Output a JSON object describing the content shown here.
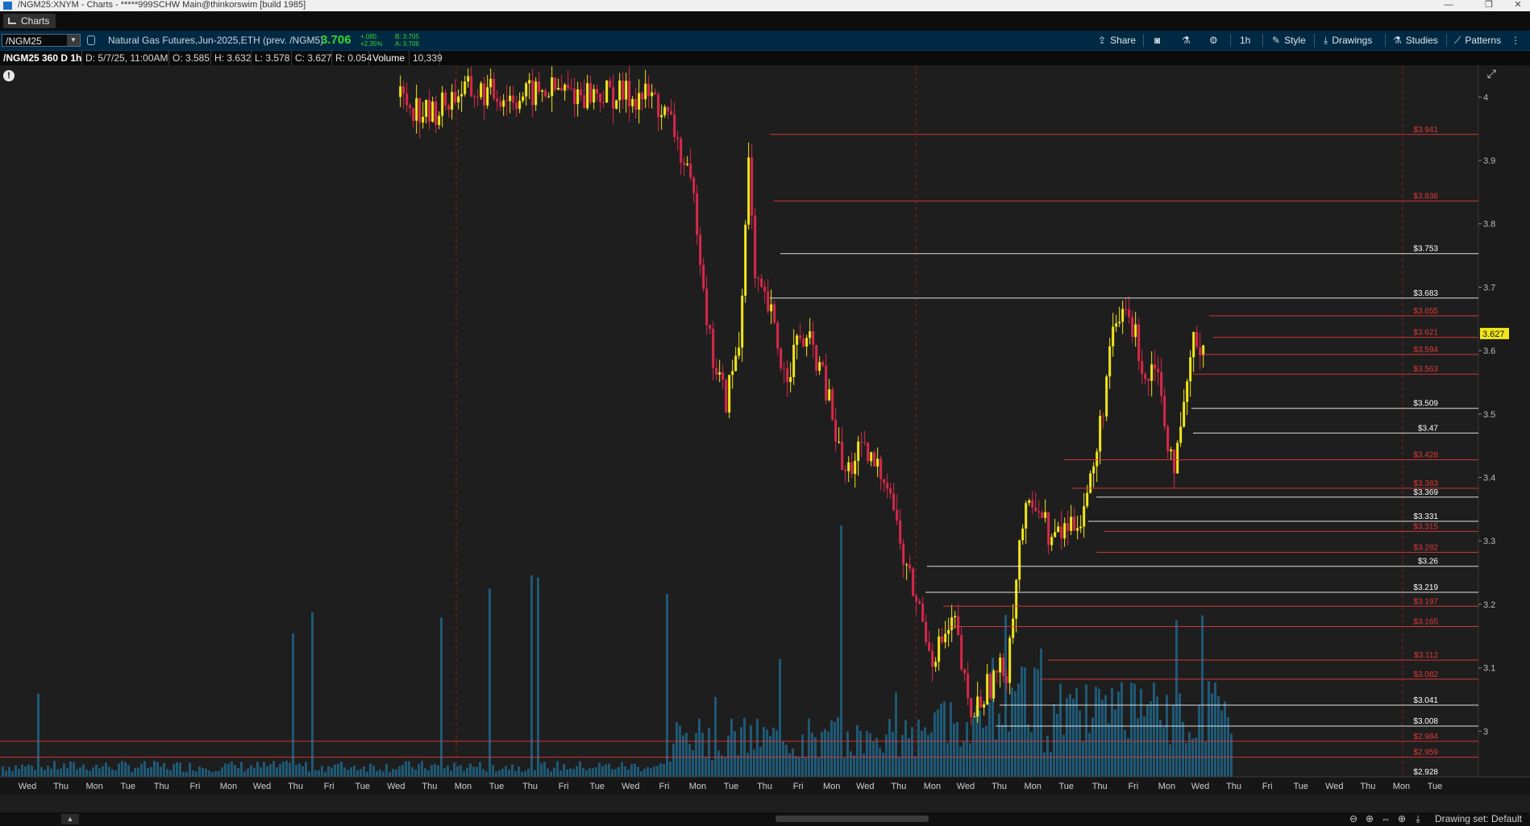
{
  "window": {
    "title": "/NGM25:XNYM - Charts - *****999SCHW Main@thinkorswim [build 1985]",
    "controls": [
      "—",
      "❐",
      "✕"
    ]
  },
  "tab": {
    "label": "Charts"
  },
  "toolbar": {
    "symbol": "/NGM25",
    "description": "Natural Gas Futures,Jun-2025,ETH (prev. /NGM5)",
    "last": "3.706",
    "change": "+.085",
    "change_pct": "+2.35%",
    "bid": "B: 3.705",
    "ask": "A: 3.706",
    "share_label": "Share",
    "timeframe_label": "1h",
    "style_label": "Style",
    "drawings_label": "Drawings",
    "studies_label": "Studies",
    "patterns_label": "Patterns"
  },
  "infobar": {
    "symbol": "/NGM25 360 D 1h",
    "date": "D: 5/7/25, 11:00AM",
    "open": "O: 3.585",
    "high": "H: 3.632",
    "low": "L: 3.578",
    "close": "C: 3.627",
    "range": "R: 0.054",
    "volume_label": "Volume",
    "volume_value": "10,339"
  },
  "chart_data": {
    "type": "candlestick",
    "instrument": "/NGM25",
    "timeframe": "1h",
    "y_axis": {
      "ticks": [
        4,
        3.9,
        3.8,
        3.7,
        3.6,
        3.5,
        3.4,
        3.3,
        3.2,
        3.1,
        3.0
      ],
      "range": [
        2.9,
        4.05
      ]
    },
    "current_price_label": "3.627",
    "x_axis_labels": [
      "Wed",
      "Thu",
      "Mon",
      "Tue",
      "Thu",
      "Fri",
      "Mon",
      "Wed",
      "Thu",
      "Fri",
      "Tue",
      "Wed",
      "Thu",
      "Mon",
      "Tue",
      "Thu",
      "Fri",
      "Tue",
      "Wed",
      "Fri",
      "Mon",
      "Tue",
      "Thu",
      "Fri",
      "Mon",
      "Wed",
      "Thu",
      "Mon",
      "Wed",
      "Thu",
      "Mon",
      "Tue",
      "Thu",
      "Fri",
      "Mon",
      "Wed",
      "Thu",
      "Fri",
      "Tue",
      "Wed",
      "Thu",
      "Mon",
      "Tue"
    ],
    "price_levels": [
      {
        "label": "$3.941",
        "value": 3.941,
        "color": "#e03a3a"
      },
      {
        "label": "$3.836",
        "value": 3.836,
        "color": "#e03a3a"
      },
      {
        "label": "$3.753",
        "value": 3.753,
        "color": "#ffffff"
      },
      {
        "label": "$3.683",
        "value": 3.683,
        "color": "#ffffff"
      },
      {
        "label": "$3.655",
        "value": 3.655,
        "color": "#e03a3a"
      },
      {
        "label": "$3.621",
        "value": 3.621,
        "color": "#e03a3a"
      },
      {
        "label": "$3.594",
        "value": 3.594,
        "color": "#e03a3a"
      },
      {
        "label": "$3.563",
        "value": 3.563,
        "color": "#e03a3a"
      },
      {
        "label": "$3.509",
        "value": 3.509,
        "color": "#ffffff"
      },
      {
        "label": "$3.47",
        "value": 3.47,
        "color": "#ffffff"
      },
      {
        "label": "$3.428",
        "value": 3.428,
        "color": "#e03a3a"
      },
      {
        "label": "$3.383",
        "value": 3.383,
        "color": "#e03a3a"
      },
      {
        "label": "$3.369",
        "value": 3.369,
        "color": "#ffffff"
      },
      {
        "label": "$3.331",
        "value": 3.331,
        "color": "#ffffff"
      },
      {
        "label": "$3.315",
        "value": 3.315,
        "color": "#e03a3a"
      },
      {
        "label": "$3.282",
        "value": 3.282,
        "color": "#e03a3a"
      },
      {
        "label": "$3.26",
        "value": 3.26,
        "color": "#ffffff"
      },
      {
        "label": "$3.219",
        "value": 3.219,
        "color": "#ffffff"
      },
      {
        "label": "$3.197",
        "value": 3.197,
        "color": "#e03a3a"
      },
      {
        "label": "$3.165",
        "value": 3.165,
        "color": "#e03a3a"
      },
      {
        "label": "$3.112",
        "value": 3.112,
        "color": "#e03a3a"
      },
      {
        "label": "$3.082",
        "value": 3.082,
        "color": "#e03a3a"
      },
      {
        "label": "$3.041",
        "value": 3.041,
        "color": "#ffffff"
      },
      {
        "label": "$3.008",
        "value": 3.008,
        "color": "#ffffff"
      },
      {
        "label": "$2.984",
        "value": 2.984,
        "color": "#e03a3a"
      },
      {
        "label": "$2.959",
        "value": 2.959,
        "color": "#e03a3a"
      },
      {
        "label": "$2.928",
        "value": 2.928,
        "color": "#ffffff"
      }
    ],
    "price_path": [
      [
        0.27,
        4.0
      ],
      [
        0.29,
        3.97
      ],
      [
        0.31,
        4.01
      ],
      [
        0.35,
        4.0
      ],
      [
        0.37,
        4.01
      ],
      [
        0.44,
        4.0
      ],
      [
        0.455,
        3.95
      ],
      [
        0.47,
        3.82
      ],
      [
        0.48,
        3.6
      ],
      [
        0.49,
        3.52
      ],
      [
        0.5,
        3.62
      ],
      [
        0.505,
        3.92
      ],
      [
        0.51,
        3.7
      ],
      [
        0.52,
        3.66
      ],
      [
        0.53,
        3.56
      ],
      [
        0.54,
        3.62
      ],
      [
        0.55,
        3.6
      ],
      [
        0.56,
        3.52
      ],
      [
        0.57,
        3.4
      ],
      [
        0.58,
        3.44
      ],
      [
        0.6,
        3.4
      ],
      [
        0.61,
        3.27
      ],
      [
        0.62,
        3.2
      ],
      [
        0.63,
        3.12
      ],
      [
        0.645,
        3.17
      ],
      [
        0.655,
        3.02
      ],
      [
        0.67,
        3.08
      ],
      [
        0.68,
        3.1
      ],
      [
        0.69,
        3.32
      ],
      [
        0.7,
        3.37
      ],
      [
        0.71,
        3.3
      ],
      [
        0.72,
        3.32
      ],
      [
        0.73,
        3.34
      ],
      [
        0.74,
        3.42
      ],
      [
        0.75,
        3.6
      ],
      [
        0.76,
        3.67
      ],
      [
        0.77,
        3.6
      ],
      [
        0.775,
        3.55
      ],
      [
        0.78,
        3.6
      ],
      [
        0.79,
        3.45
      ],
      [
        0.795,
        3.42
      ],
      [
        0.8,
        3.5
      ],
      [
        0.805,
        3.6
      ],
      [
        0.81,
        3.62
      ],
      [
        0.815,
        3.6
      ]
    ],
    "annotations": []
  },
  "statusbar": {
    "scroll_up_icon": "up-arrow-icon",
    "drawing_set": "Drawing set: Default"
  }
}
